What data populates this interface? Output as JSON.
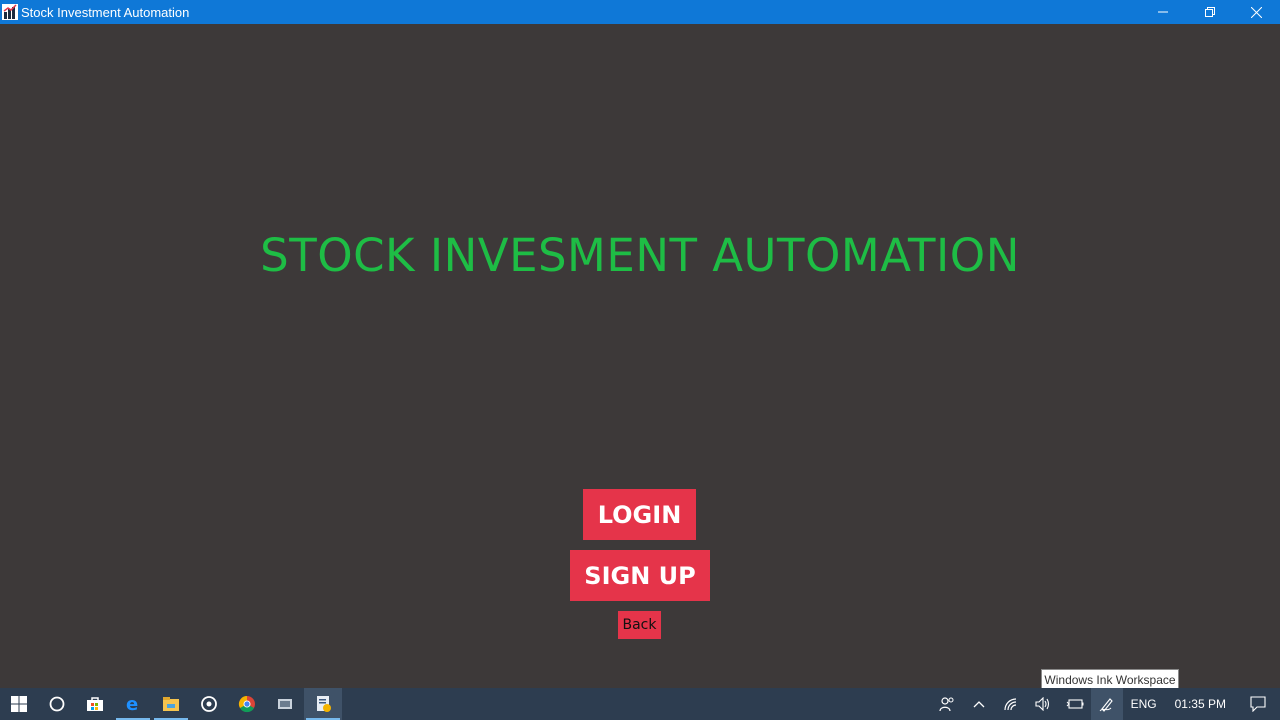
{
  "window": {
    "title": "Stock Investment Automation",
    "minimize_symbol": "—",
    "restore_symbol": "❐",
    "close_symbol": "✕"
  },
  "main": {
    "heading": "STOCK INVESMENT AUTOMATION",
    "login_label": "LOGIN",
    "signup_label": "SIGN UP",
    "back_label": "Back"
  },
  "tooltip": {
    "text": "Windows Ink Workspace"
  },
  "taskbar": {
    "apps": [
      "start-icon",
      "cortana-icon",
      "store-icon",
      "edge-icon",
      "file-explorer-icon",
      "groove-icon",
      "chrome-icon",
      "app-icon",
      "active-app-icon"
    ],
    "language": "ENG",
    "time": "01:35 PM"
  },
  "colors": {
    "title_bar": "#0f78d7",
    "background": "#3d3939",
    "heading": "#1ebd45",
    "button": "#e5344a",
    "taskbar": "#2d3d50"
  }
}
